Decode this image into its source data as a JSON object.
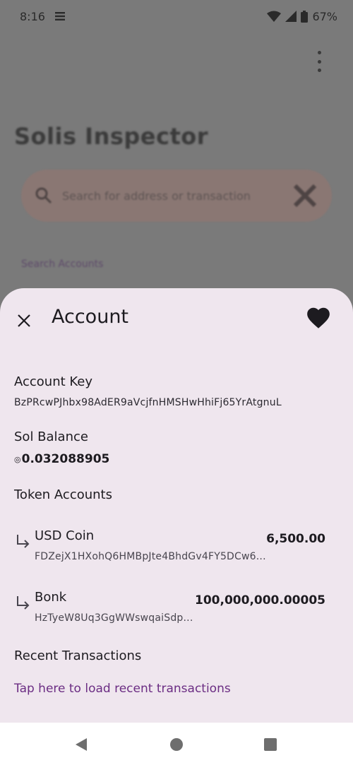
{
  "status": {
    "time": "8:16",
    "battery": "67%"
  },
  "background": {
    "title": "Solis Inspector",
    "search_placeholder": "Search for address or transaction",
    "link": "Search Accounts"
  },
  "sheet": {
    "title": "Account",
    "account_key_label": "Account Key",
    "account_key": "BzPRcwPJhbx98AdER9aVcjfnHMSHwHhiFj65YrAtgnuL",
    "sol_balance_label": "Sol Balance",
    "sol_symbol": "◎",
    "sol_balance": "0.032088905",
    "token_accounts_label": "Token Accounts",
    "tokens": [
      {
        "name": "USD Coin",
        "address": "FDZejX1HXohQ6HMBpJte4BhdGv4FY5DCw6...",
        "amount": "6,500.00"
      },
      {
        "name": "Bonk",
        "address": "HzTyeW8Uq3GgWWswqaiSdp...",
        "amount": "100,000,000.00005"
      }
    ],
    "recent_transactions_label": "Recent Transactions",
    "load_transactions_link": "Tap here to load recent transactions"
  },
  "colors": {
    "sheet_bg": "#efe6ee",
    "link": "#6b2d83",
    "scrim": "#7a7a7a"
  }
}
